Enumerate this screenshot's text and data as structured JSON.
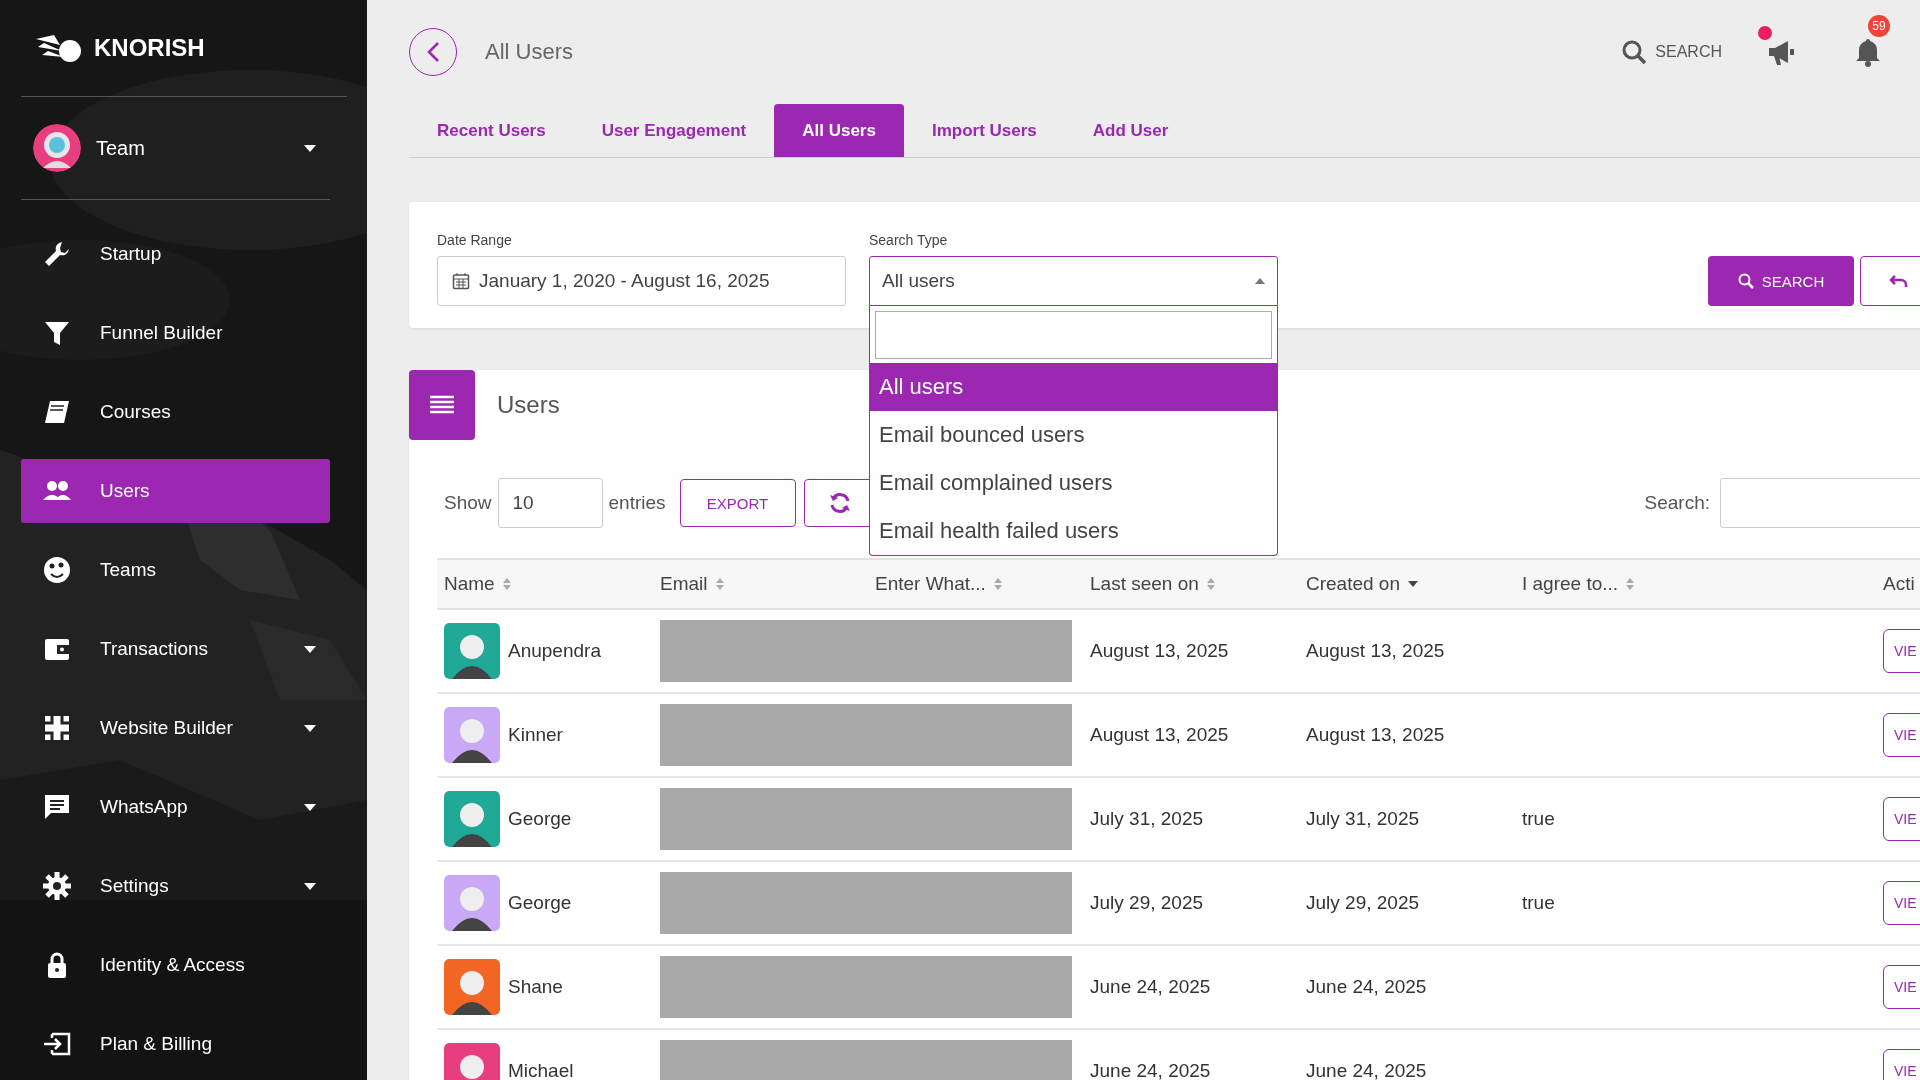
{
  "sidebar": {
    "brand": "KNORISH",
    "team": {
      "label": "Team",
      "expandable": true
    },
    "items": [
      {
        "label": "Startup",
        "selected": false,
        "expandable": false
      },
      {
        "label": "Funnel Builder",
        "selected": false,
        "expandable": false
      },
      {
        "label": "Courses",
        "selected": false,
        "expandable": false
      },
      {
        "label": "Users",
        "selected": true,
        "expandable": false
      },
      {
        "label": "Teams",
        "selected": false,
        "expandable": false
      },
      {
        "label": "Transactions",
        "selected": false,
        "expandable": true
      },
      {
        "label": "Website Builder",
        "selected": false,
        "expandable": true
      },
      {
        "label": "WhatsApp",
        "selected": false,
        "expandable": true
      },
      {
        "label": "Settings",
        "selected": false,
        "expandable": true
      },
      {
        "label": "Identity & Access",
        "selected": false,
        "expandable": false
      },
      {
        "label": "Plan & Billing",
        "selected": false,
        "expandable": false
      }
    ]
  },
  "header": {
    "title": "All Users",
    "search_label": "SEARCH",
    "announcement_unread": true,
    "notification_count": "59"
  },
  "tabs": [
    {
      "label": "Recent Users",
      "selected": false
    },
    {
      "label": "User Engagement",
      "selected": false
    },
    {
      "label": "All Users",
      "selected": true
    },
    {
      "label": "Import Users",
      "selected": false
    },
    {
      "label": "Add User",
      "selected": false
    }
  ],
  "filters": {
    "date_range": {
      "label": "Date Range",
      "value": "January 1, 2020 - August 16, 2025"
    },
    "search_type": {
      "label": "Search Type",
      "value": "All users",
      "expanded": true,
      "options": [
        {
          "label": "All users",
          "selected": true
        },
        {
          "label": "Email bounced users",
          "selected": false
        },
        {
          "label": "Email complained users",
          "selected": false
        },
        {
          "label": "Email health failed users",
          "selected": false
        }
      ]
    },
    "search_button": "SEARCH"
  },
  "users_panel": {
    "title": "Users",
    "show_label": "Show",
    "page_size": "10",
    "entries_label": "entries",
    "export_button": "EXPORT",
    "search_label": "Search:",
    "columns": [
      {
        "label": "Name",
        "sortable": true,
        "sorted": false
      },
      {
        "label": "Email",
        "sortable": true,
        "sorted": false
      },
      {
        "label": "Enter What...",
        "sortable": true,
        "sorted": false
      },
      {
        "label": "Last seen on",
        "sortable": true,
        "sorted": false
      },
      {
        "label": "Created on",
        "sortable": true,
        "sorted": true
      },
      {
        "label": "I agree to...",
        "sortable": true,
        "sorted": false
      },
      {
        "label": "Acti",
        "sortable": false
      }
    ],
    "rows": [
      {
        "name": "Anupendra",
        "color": "#1fa996",
        "email_redacted": true,
        "last_seen": "August 13, 2025",
        "created": "August 13, 2025",
        "action": "VIE"
      },
      {
        "name": "Kinner",
        "color": "#c9a8f5",
        "email_redacted": true,
        "last_seen": "August 13, 2025",
        "created": "August 13, 2025",
        "action": "VIE"
      },
      {
        "name": "George",
        "color": "#1fa996",
        "email_redacted": true,
        "last_seen": "July 31, 2025",
        "created": "July 31, 2025",
        "agree": "true",
        "action": "VIE"
      },
      {
        "name": "George",
        "color": "#c9a8f5",
        "email_redacted": true,
        "last_seen": "July 29, 2025",
        "created": "July 29, 2025",
        "agree": "true",
        "action": "VIE"
      },
      {
        "name": "Shane",
        "color": "#f26522",
        "email_redacted": true,
        "last_seen": "June 24, 2025",
        "created": "June 24, 2025",
        "action": "VIE"
      },
      {
        "name": "Michael",
        "color": "#e83e7f",
        "email_redacted": true,
        "last_seen": "June 24, 2025",
        "created": "June 24, 2025",
        "action": "VIE"
      }
    ]
  }
}
